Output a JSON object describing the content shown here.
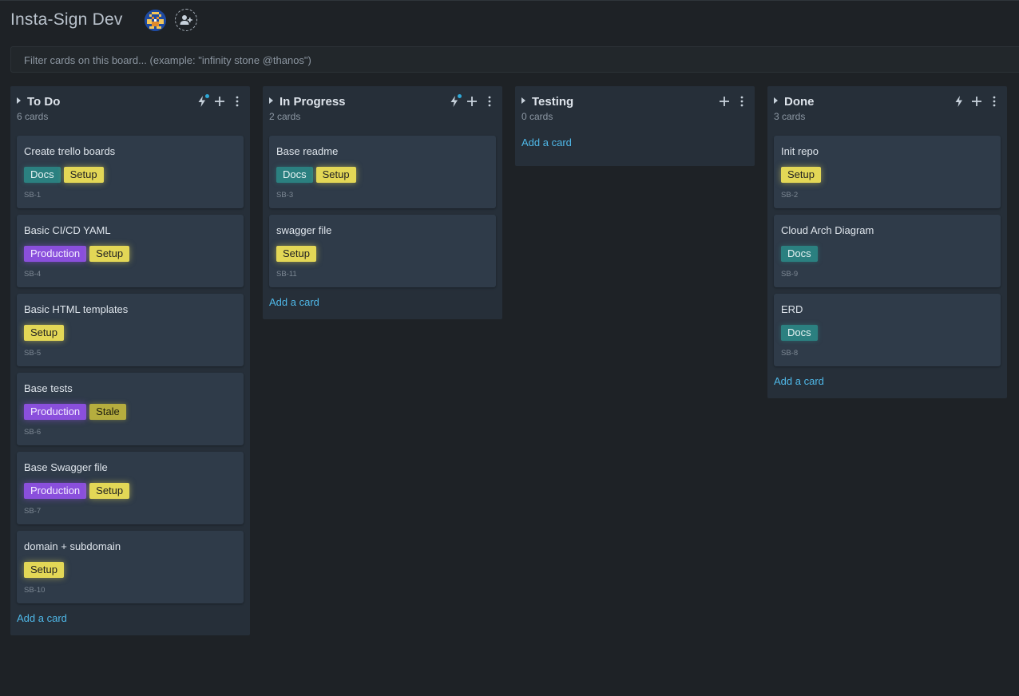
{
  "board": {
    "title": "Insta-Sign Dev",
    "filter_placeholder": "Filter cards on this board... (example: \"infinity stone @thanos\")"
  },
  "colors": {
    "background": "#1e2226",
    "column": "#262f39",
    "card": "#2f3b49",
    "link": "#4fb8e8",
    "label_docs": "#2b8080",
    "label_setup": "#e3d756",
    "label_production": "#8a4fdc",
    "label_stale": "#b5ad3e"
  },
  "columns": [
    {
      "title": "To Do",
      "count": "6 cards",
      "add_label": "Add a card",
      "cards": [
        {
          "title": "Create trello boards",
          "labels": [
            "Docs",
            "Setup"
          ],
          "id": "SB-1"
        },
        {
          "title": "Basic CI/CD YAML",
          "labels": [
            "Production",
            "Setup"
          ],
          "id": "SB-4"
        },
        {
          "title": "Basic HTML templates",
          "labels": [
            "Setup"
          ],
          "id": "SB-5"
        },
        {
          "title": "Base tests",
          "labels": [
            "Production",
            "Stale"
          ],
          "id": "SB-6"
        },
        {
          "title": "Base Swagger file",
          "labels": [
            "Production",
            "Setup"
          ],
          "id": "SB-7"
        },
        {
          "title": "domain + subdomain",
          "labels": [
            "Setup"
          ],
          "id": "SB-10"
        }
      ]
    },
    {
      "title": "In Progress",
      "count": "2 cards",
      "add_label": "Add a card",
      "cards": [
        {
          "title": "Base readme",
          "labels": [
            "Docs",
            "Setup"
          ],
          "id": "SB-3"
        },
        {
          "title": "swagger file",
          "labels": [
            "Setup"
          ],
          "id": "SB-11"
        }
      ]
    },
    {
      "title": "Testing",
      "count": "0 cards",
      "add_label": "Add a card",
      "cards": []
    },
    {
      "title": "Done",
      "count": "3 cards",
      "add_label": "Add a card",
      "cards": [
        {
          "title": "Init repo",
          "labels": [
            "Setup"
          ],
          "id": "SB-2"
        },
        {
          "title": "Cloud Arch Diagram",
          "labels": [
            "Docs"
          ],
          "id": "SB-9"
        },
        {
          "title": "ERD",
          "labels": [
            "Docs"
          ],
          "id": "SB-8"
        }
      ]
    }
  ]
}
